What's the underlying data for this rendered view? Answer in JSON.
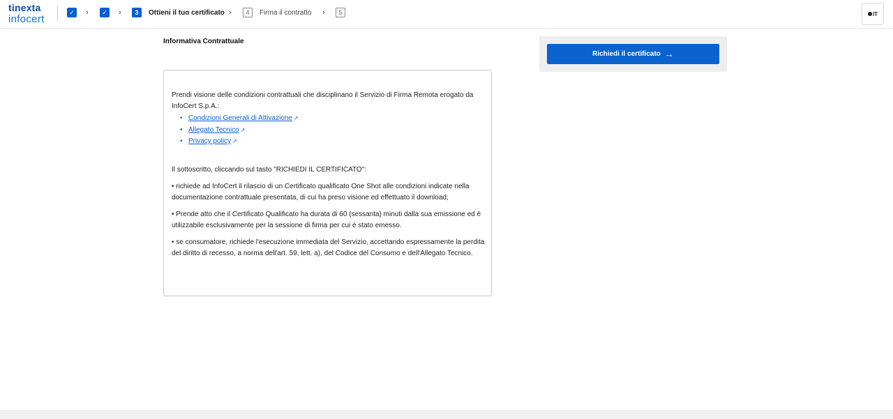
{
  "brand": {
    "top": "tinexta",
    "bottom": "infocert"
  },
  "stepper": {
    "steps": [
      {
        "number": "",
        "label": "",
        "state": "done"
      },
      {
        "number": "",
        "label": "",
        "state": "done"
      },
      {
        "number": "3",
        "label": "Ottieni il tuo certificato",
        "state": "current"
      },
      {
        "number": "4",
        "label": "Firma il contratto",
        "state": "future"
      },
      {
        "number": "5",
        "label": "",
        "state": "future"
      }
    ],
    "check_glyph": "✓",
    "chevron_glyph": "›"
  },
  "language": {
    "label": "IT"
  },
  "section_title": "Informativa Contrattuale",
  "contract": {
    "intro": "Prendi visione delle condizioni contrattuali che disciplinano il Servizio di Firma Remota erogato da InfoCert S.p.A.:",
    "links": [
      {
        "label": " Condizioni Generali di Attivazione"
      },
      {
        "label": " Allegato Tecnico"
      },
      {
        "label": " Privacy policy"
      }
    ],
    "external_glyph": "↗",
    "bullet_glyph": "•",
    "declaration": "Il sottoscritto, cliccando sul tasto \"RICHIEDI IL CERTIFICATO\":",
    "bullets": [
      "• richiede ad InfoCert il rilascio di un Certificato qualificato One Shot alle condizioni indicate nella documentazione contrattuale presentata, di cui ha preso visione ed effettuato il download;",
      "• Prende atto che il Certificato Qualificato ha durata di 60 (sessanta) minuti dalla sua emissione ed è utilizzabile esclusivamente per la sessione di firma per cui è stato emesso.",
      "• se consumatore, richiede l'esecuzione immediata del Servizio, accettando espressamente la perdita del diritto di recesso, a norma dell'art. 59, lett. a), del Codice del Consumo e dell'Allegato Tecnico."
    ]
  },
  "cta": {
    "label": "Richiedi il certificato",
    "arrow_glyph": "→"
  },
  "colors": {
    "accent": "#0a63cf",
    "panel": "#eeeeee",
    "link": "#0a5fd0"
  }
}
